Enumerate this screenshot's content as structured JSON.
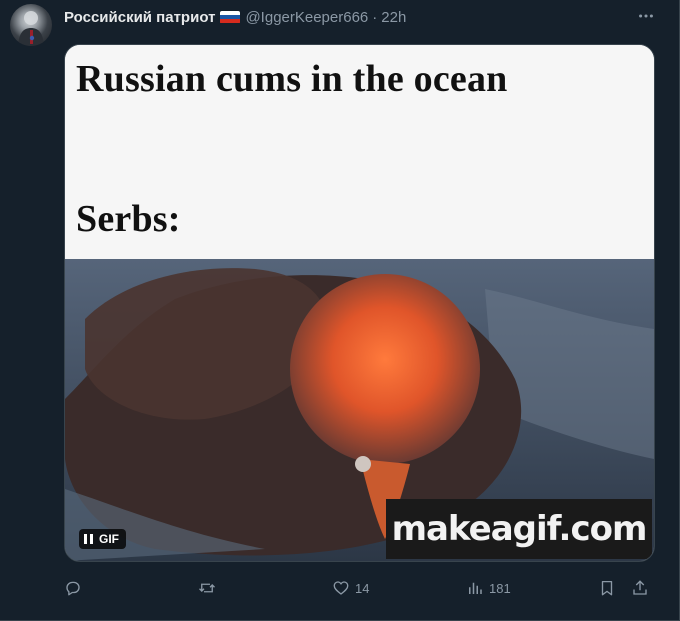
{
  "tweet": {
    "author": {
      "display_name": "Российский патриот",
      "flag_icon": "russia-flag-icon",
      "handle": "@IggerKeeper666",
      "separator": "·",
      "time": "22h"
    },
    "media": {
      "caption_line_1": "Russian cums in the ocean",
      "caption_line_2": "Serbs:",
      "watermark": "makeagif.com",
      "gif_badge": "GIF",
      "playback_state": "playing"
    },
    "actions": {
      "reply_count": "",
      "retweet_count": "",
      "like_count": "14",
      "view_count": "181"
    }
  },
  "colors": {
    "background": "#15202b",
    "text_primary": "#e7e9ea",
    "text_secondary": "#8b98a5",
    "divider": "#38444d"
  }
}
